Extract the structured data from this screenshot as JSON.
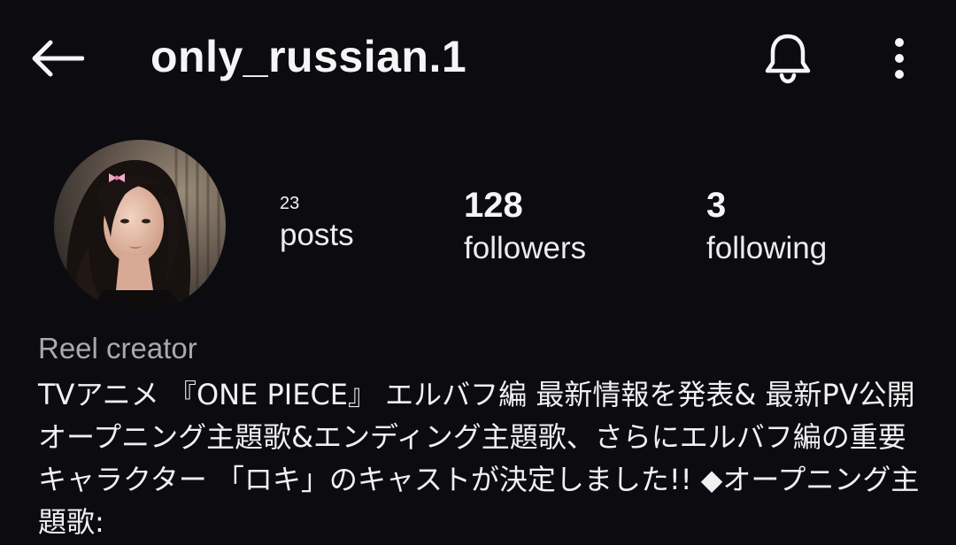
{
  "header": {
    "username": "only_russian.1",
    "icons": {
      "back": "arrow-left-icon",
      "notifications": "bell-icon",
      "more": "more-vertical-icon"
    }
  },
  "profile": {
    "stats": {
      "posts": {
        "count": "23",
        "label": "posts"
      },
      "followers": {
        "count": "128",
        "label": "followers"
      },
      "following": {
        "count": "3",
        "label": "following"
      }
    },
    "category": "Reel creator",
    "bio": "TVアニメ 『ONE PIECE』 エルバフ編 最新情報を発表& 最新PV公開 オープニング主題歌&エンディング主題歌、さらにエルバフ編の重要キャラクター 「ロキ」のキャストが決定しました!! ◆オープニング主題歌:"
  },
  "colors": {
    "background": "#0b0b10",
    "text": "#f2f2f2",
    "secondary_text": "#a9a9b0"
  }
}
